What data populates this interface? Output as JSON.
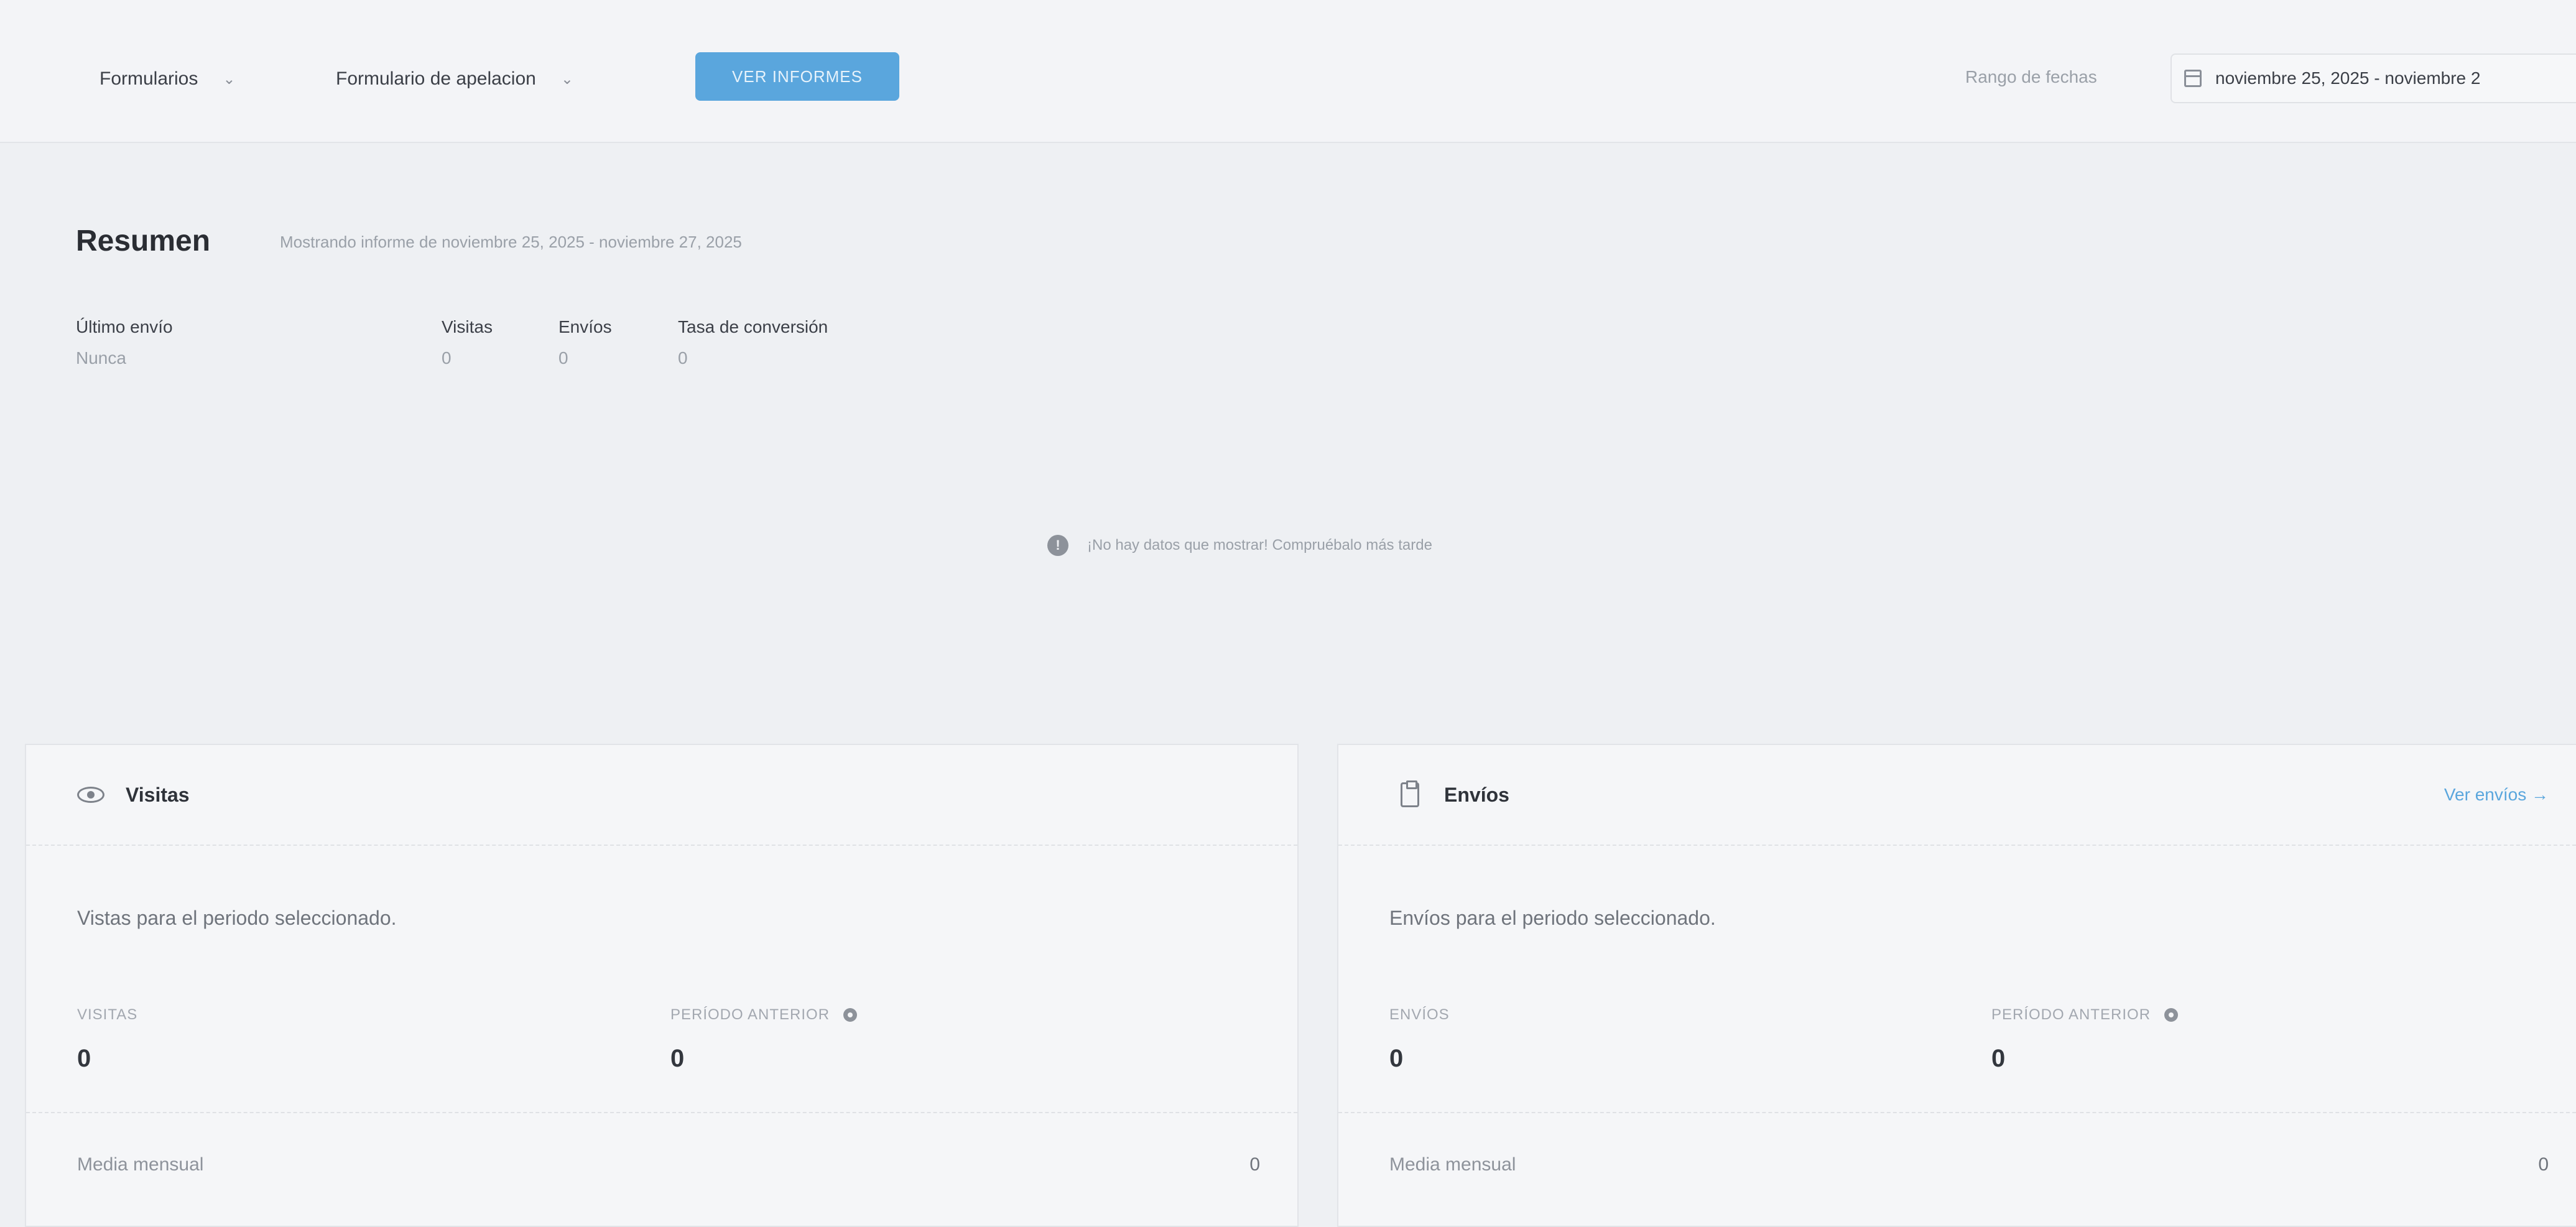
{
  "toolbar": {
    "forms_select": "Formularios",
    "form_select": "Formulario de apelacion",
    "report_button": "VER INFORMES",
    "range_label": "Rango de fechas",
    "range_value": "noviembre 25, 2025 - noviembre 2"
  },
  "summary": {
    "title": "Resumen",
    "subtitle": "Mostrando informe de noviembre 25, 2025 - noviembre 27, 2025",
    "last_send_label": "Último envío",
    "last_send_value": "Nunca",
    "visits_label": "Visitas",
    "visits_value": "0",
    "sends_label": "Envíos",
    "sends_value": "0",
    "rate_label": "Tasa de conversión",
    "rate_value": "0",
    "no_data": "¡No hay datos que mostrar! Compruébalo más tarde"
  },
  "visits_card": {
    "title": "Visitas",
    "description": "Vistas para el periodo seleccionado.",
    "metric_label": "VISITAS",
    "metric_value": "0",
    "prev_label": "PERÍODO ANTERIOR",
    "prev_value": "0",
    "monthly_label": "Media mensual",
    "monthly_value": "0"
  },
  "sends_card": {
    "title": "Envíos",
    "link": "Ver envíos →",
    "description": "Envíos para el periodo seleccionado.",
    "metric_label": "ENVÍOS",
    "metric_value": "0",
    "prev_label": "PERÍODO ANTERIOR",
    "prev_value": "0",
    "monthly_label": "Media mensual",
    "monthly_value": "0"
  },
  "colors": {
    "accent": "#5aa6dd",
    "background": "#eef0f3",
    "card": "#f5f6f8"
  }
}
